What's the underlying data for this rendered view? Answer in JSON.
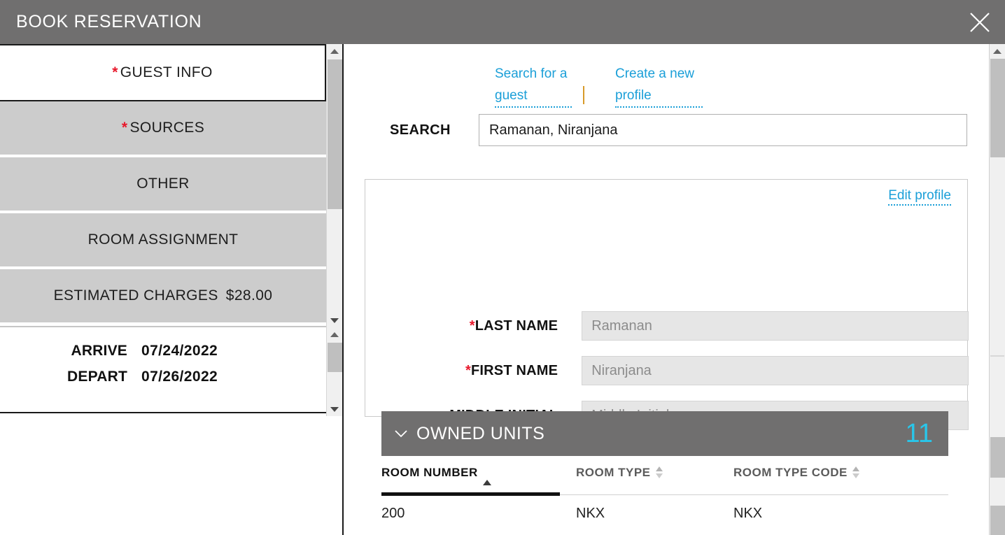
{
  "window": {
    "title": "BOOK RESERVATION",
    "close_icon": "close-icon"
  },
  "sidebar": {
    "tabs": [
      {
        "label": "GUEST INFO",
        "required": true,
        "active": true
      },
      {
        "label": "SOURCES",
        "required": true,
        "active": false
      },
      {
        "label": "OTHER",
        "required": false,
        "active": false
      },
      {
        "label": "ROOM ASSIGNMENT",
        "required": false,
        "active": false
      },
      {
        "label": "ESTIMATED CHARGES",
        "required": false,
        "active": false,
        "amount": "$28.00"
      }
    ],
    "dates": [
      {
        "label": "ARRIVE",
        "value": "07/24/2022"
      },
      {
        "label": "DEPART",
        "value": "07/26/2022"
      }
    ]
  },
  "main": {
    "links": {
      "search_guest": "Search for a guest",
      "separator": "|",
      "create_profile": "Create a new profile"
    },
    "search": {
      "label": "SEARCH",
      "value": "Ramanan, Niranjana",
      "placeholder": ""
    },
    "profile": {
      "edit_link": "Edit profile",
      "fields": [
        {
          "label": "LAST NAME",
          "required": true,
          "value": "",
          "placeholder": "Ramanan"
        },
        {
          "label": "FIRST NAME",
          "required": true,
          "value": "",
          "placeholder": "Niranjana"
        },
        {
          "label": "MIDDLE INITIAL",
          "required": false,
          "value": "",
          "placeholder": "Middle Initial"
        }
      ]
    },
    "owned_units": {
      "title": "OWNED UNITS",
      "count": "11",
      "expanded": true,
      "columns": [
        {
          "label": "ROOM NUMBER",
          "sort": "asc"
        },
        {
          "label": "ROOM TYPE",
          "sort": "none"
        },
        {
          "label": "ROOM TYPE CODE",
          "sort": "none"
        }
      ],
      "rows": [
        {
          "room_number": "200",
          "room_type": "NKX",
          "room_type_code": "NKX"
        }
      ]
    }
  },
  "colors": {
    "header_gray": "#706f6f",
    "tab_gray": "#cccccc",
    "link_blue": "#1b9fd8",
    "count_cyan": "#29c6ea",
    "required_red": "#e8192c",
    "field_gray": "#e6e6e6"
  }
}
